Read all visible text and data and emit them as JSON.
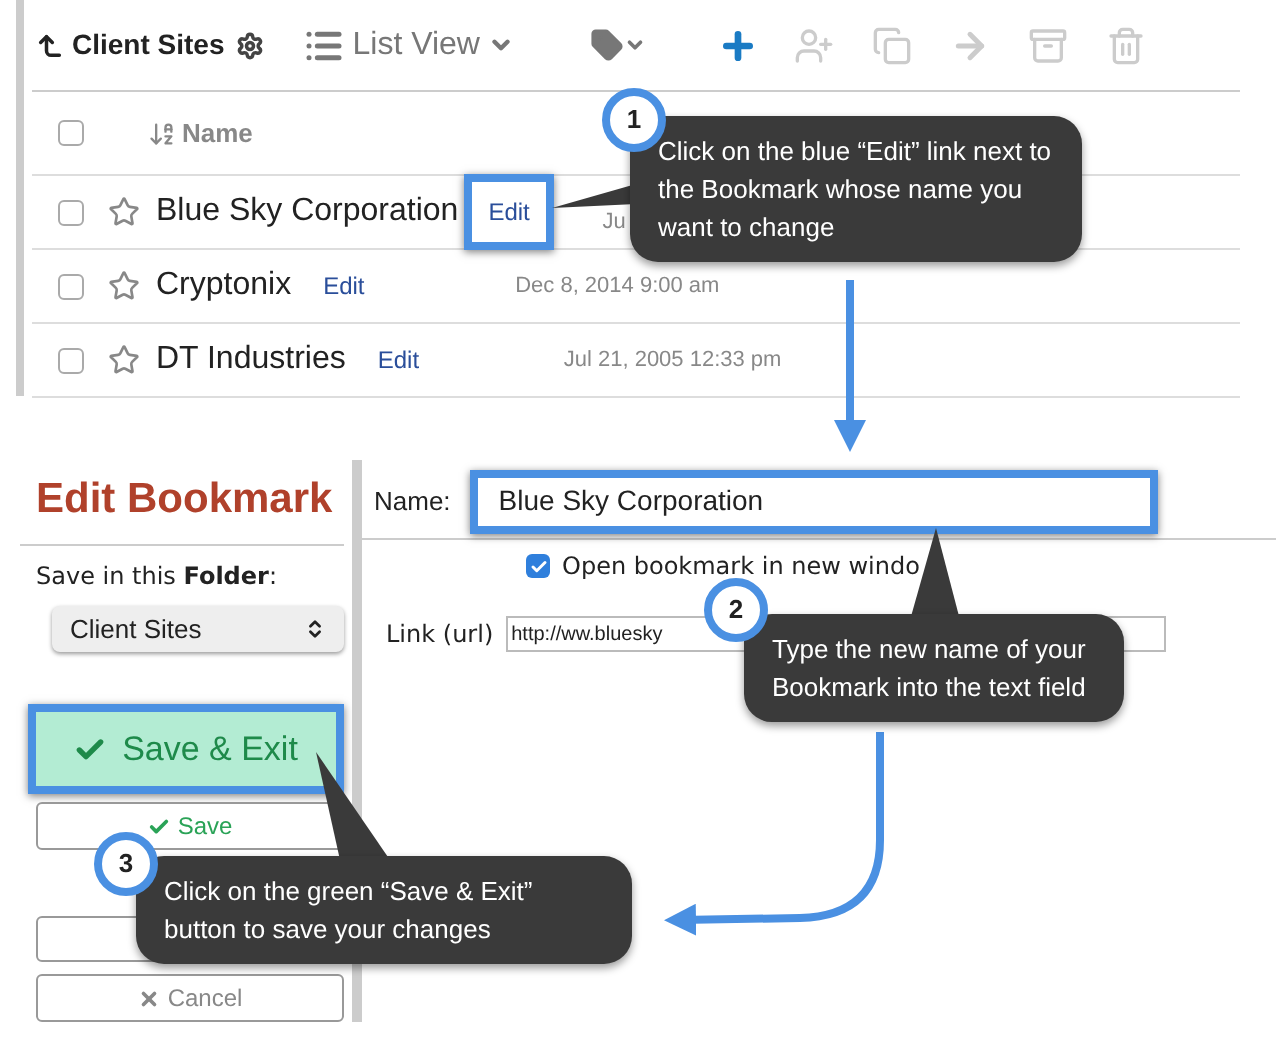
{
  "toolbar": {
    "folder": "Client Sites",
    "view": "List View"
  },
  "list": {
    "column": "Name",
    "all_checked": false,
    "rows": [
      {
        "checked": false,
        "name": "Blue Sky Corporation",
        "action": "Edit",
        "date": "Ju",
        "highlighted": true
      },
      {
        "checked": false,
        "name": "Cryptonix",
        "action": "Edit",
        "date": "Dec 8, 2014 9:00 am",
        "highlighted": false
      },
      {
        "checked": false,
        "name": "DT Industries",
        "action": "Edit",
        "date": "Jul 21, 2005 12:33 pm",
        "highlighted": false
      }
    ]
  },
  "editor": {
    "title": "Edit Bookmark",
    "folder_label": "Save in this **Folder**:",
    "folder": "Client Sites",
    "buttons": [
      {
        "kind": "primary",
        "label": "Save & Exit",
        "highlighted": true
      },
      {
        "kind": "secondary",
        "label": "Save",
        "highlighted": false
      },
      {
        "kind": "blank",
        "highlighted": false
      },
      {
        "kind": "cancel",
        "label": "Cancel",
        "highlighted": false
      }
    ],
    "name_label": "Name:",
    "name": "Blue Sky Corporation",
    "name_highlighted": true,
    "new_window": {
      "label": "Open bookmark in new windo",
      "checked": true
    },
    "link_label": "Link (url)",
    "link": "http://ww.bluesky"
  },
  "callouts": [
    {
      "number": "1",
      "text": "Click on the blue “Edit” link next to the Bookmark whose name you want to change"
    },
    {
      "number": "2",
      "text": "Type the new name of your Bookmark into the text field"
    },
    {
      "number": "3",
      "text": "Click on the green “Save & Exit” button to save your changes"
    }
  ]
}
